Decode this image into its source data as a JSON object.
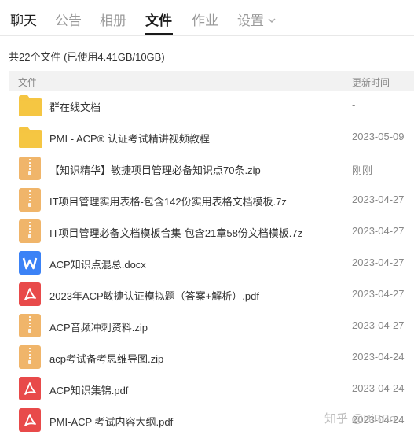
{
  "tabs": [
    {
      "label": "聊天",
      "active": false
    },
    {
      "label": "公告",
      "active": false
    },
    {
      "label": "相册",
      "active": false
    },
    {
      "label": "文件",
      "active": true
    },
    {
      "label": "作业",
      "active": false
    },
    {
      "label": "设置",
      "active": false,
      "icon": "chevron-down-icon"
    }
  ],
  "summary": "共22个文件 (已使用4.41GB/10GB)",
  "columns": {
    "name": "文件",
    "time": "更新时间"
  },
  "files": [
    {
      "name": "群在线文档",
      "time": "-",
      "type": "folder"
    },
    {
      "name": "PMI - ACP® 认证考试精讲视频教程",
      "time": "2023-05-09",
      "type": "folder"
    },
    {
      "name": "【知识精华】敏捷项目管理必备知识点70条.zip",
      "time": "刚刚",
      "type": "zip"
    },
    {
      "name": "IT项目管理实用表格-包含142份实用表格文档模板.7z",
      "time": "2023-04-27",
      "type": "zip"
    },
    {
      "name": "IT项目管理必备文档模板合集-包含21章58份文档模板.7z",
      "time": "2023-04-27",
      "type": "zip"
    },
    {
      "name": "ACP知识点混总.docx",
      "time": "2023-04-27",
      "type": "docx"
    },
    {
      "name": "2023年ACP敏捷认证模拟题（答案+解析）.pdf",
      "time": "2023-04-27",
      "type": "pdf"
    },
    {
      "name": "ACP音频冲刺资料.zip",
      "time": "2023-04-27",
      "type": "zip"
    },
    {
      "name": "acp考试备考思维导图.zip",
      "time": "2023-04-24",
      "type": "zip"
    },
    {
      "name": "ACP知识集锦.pdf",
      "time": "2023-04-24",
      "type": "pdf"
    },
    {
      "name": "PMI-ACP 考试内容大纲.pdf",
      "time": "2023-04-24",
      "type": "pdf"
    }
  ],
  "watermark": "知乎 @BiBBo",
  "colors": {
    "folder": "#f5c542",
    "zip": "#f0b56a",
    "docx": "#3b82f6",
    "pdf": "#e84a4a"
  }
}
